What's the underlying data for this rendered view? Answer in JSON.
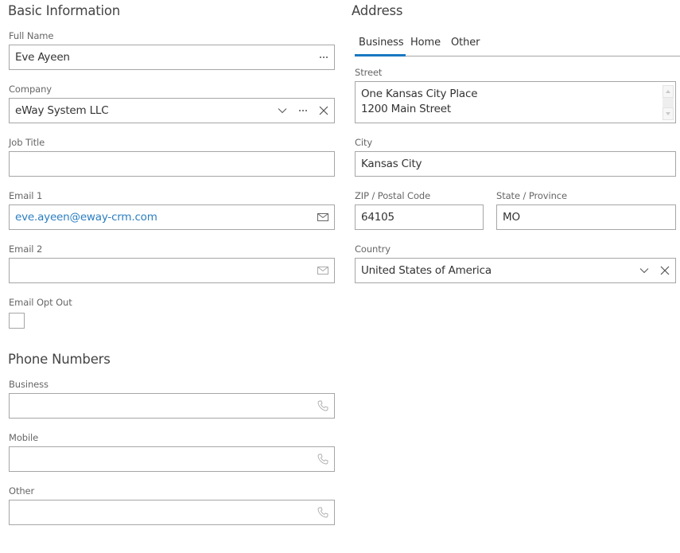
{
  "basic_info": {
    "title": "Basic Information",
    "full_name": {
      "label": "Full Name",
      "value": "Eve Ayeen"
    },
    "company": {
      "label": "Company",
      "value": "eWay System LLC"
    },
    "job_title": {
      "label": "Job Title",
      "value": ""
    },
    "email1": {
      "label": "Email 1",
      "value": "eve.ayeen@eway-crm.com"
    },
    "email2": {
      "label": "Email 2",
      "value": ""
    },
    "email_opt_out": {
      "label": "Email Opt Out",
      "checked": false
    }
  },
  "phone_numbers": {
    "title": "Phone Numbers",
    "business": {
      "label": "Business",
      "value": ""
    },
    "mobile": {
      "label": "Mobile",
      "value": ""
    },
    "other": {
      "label": "Other",
      "value": ""
    }
  },
  "address": {
    "title": "Address",
    "tabs": [
      {
        "label": "Business",
        "active": true
      },
      {
        "label": "Home",
        "active": false
      },
      {
        "label": "Other",
        "active": false
      }
    ],
    "street": {
      "label": "Street",
      "line1": "One Kansas City Place",
      "line2": "1200 Main Street"
    },
    "city": {
      "label": "City",
      "value": "Kansas City"
    },
    "zip": {
      "label": "ZIP / Postal Code",
      "value": "64105"
    },
    "state": {
      "label": "State / Province",
      "value": "MO"
    },
    "country": {
      "label": "Country",
      "value": "United States of America"
    }
  },
  "colors": {
    "accent": "#1a78c2",
    "link": "#2b7ec1",
    "border": "#a6a6a6"
  }
}
